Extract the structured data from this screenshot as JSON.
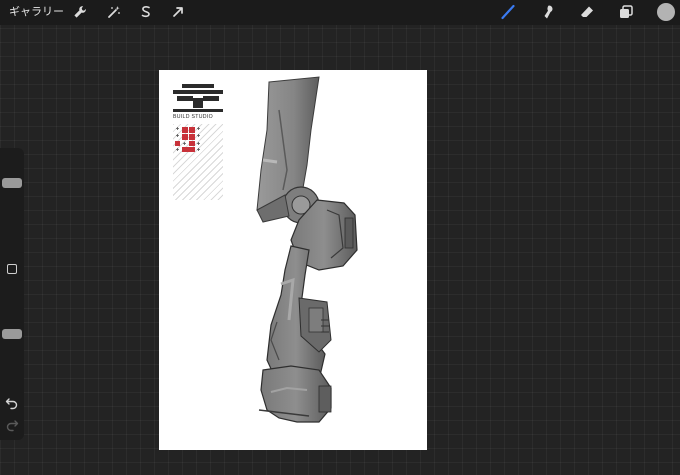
{
  "topbar": {
    "gallery_label": "ギャラリー",
    "left_tools": [
      {
        "name": "wrench-icon"
      },
      {
        "name": "magic-wand-icon"
      },
      {
        "name": "selection-icon"
      },
      {
        "name": "transform-arrow-icon"
      }
    ],
    "right_tools": [
      {
        "name": "brush-icon",
        "active": true
      },
      {
        "name": "smudge-icon"
      },
      {
        "name": "eraser-icon"
      },
      {
        "name": "layers-icon"
      }
    ],
    "active_color": "#b3b3b3",
    "active_tool_color": "#3a7bf2"
  },
  "sidebar": {
    "brush_size_level": 0.75,
    "opacity_level": 0.5,
    "icons": [
      "modify-square-icon",
      "undo-icon",
      "redo-icon"
    ]
  },
  "canvas": {
    "logo_text": "BUILD STUDIO",
    "background": "#ffffff"
  }
}
